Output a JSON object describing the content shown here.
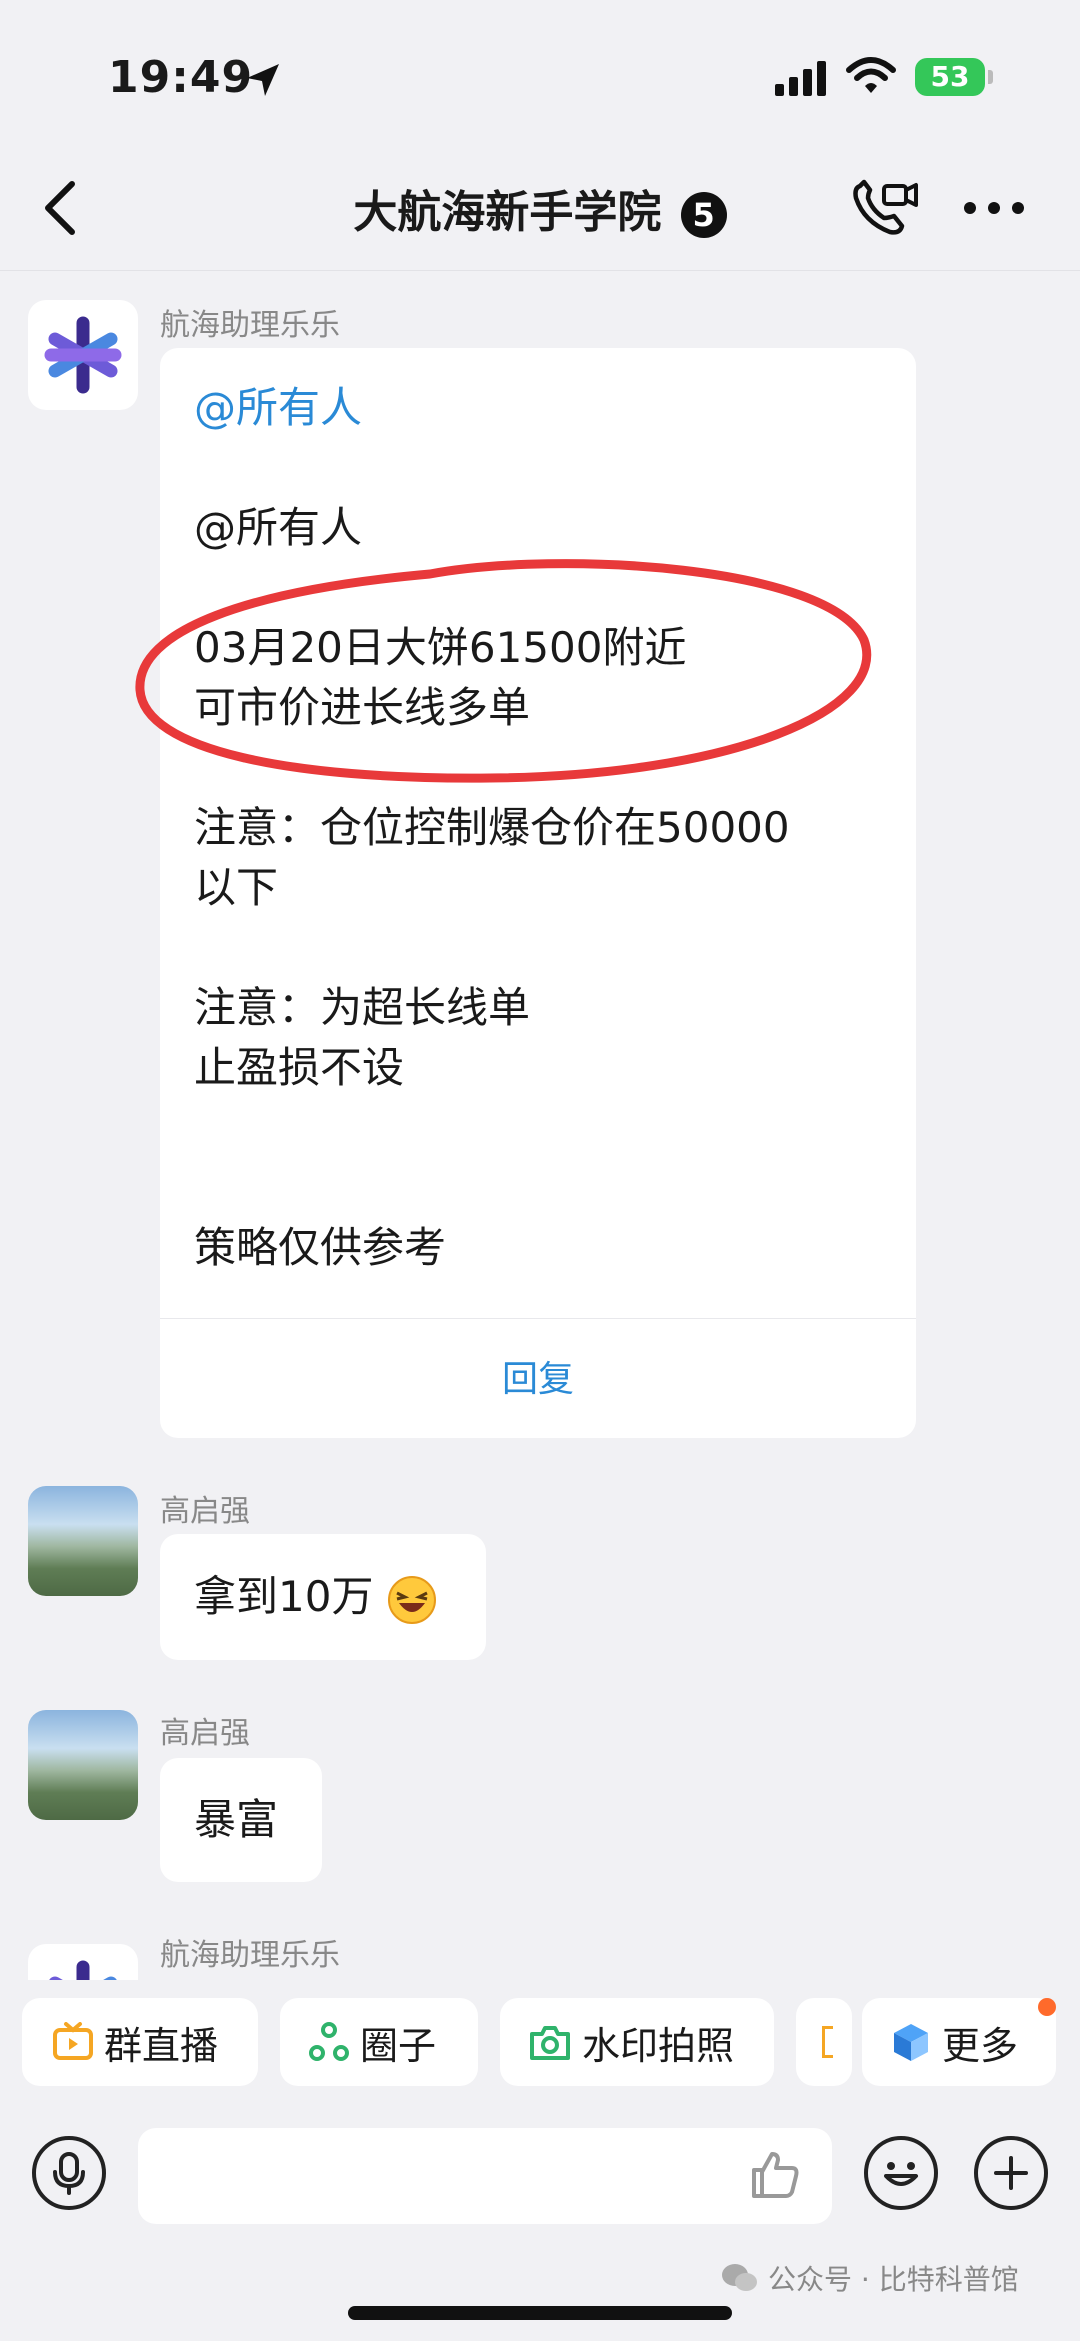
{
  "status_bar": {
    "time": "19:49",
    "battery": "53"
  },
  "header": {
    "title": "大航海新手学院",
    "badge": "5"
  },
  "messages": [
    {
      "sender": "航海助理乐乐",
      "lines": [
        "@所有人",
        "@所有人",
        "03月20日大饼61500附近",
        "可市价进长线多单",
        "注意：仓位控制爆仓价在50000",
        "以下",
        "注意：为超长线单",
        "止盈损不设",
        "策略仅供参考"
      ],
      "reply": "回复"
    },
    {
      "sender": "高启强",
      "text": "拿到10万"
    },
    {
      "sender": "高启强",
      "text": "暴富"
    },
    {
      "sender": "航海助理乐乐"
    }
  ],
  "shortcuts": [
    "群直播",
    "圈子",
    "水印拍照",
    "更多"
  ],
  "watermark": "公众号 · 比特科普馆",
  "colors": {
    "accent": "#2a8ad6",
    "highlight_circle": "#e8393a",
    "battery": "#34c759"
  }
}
